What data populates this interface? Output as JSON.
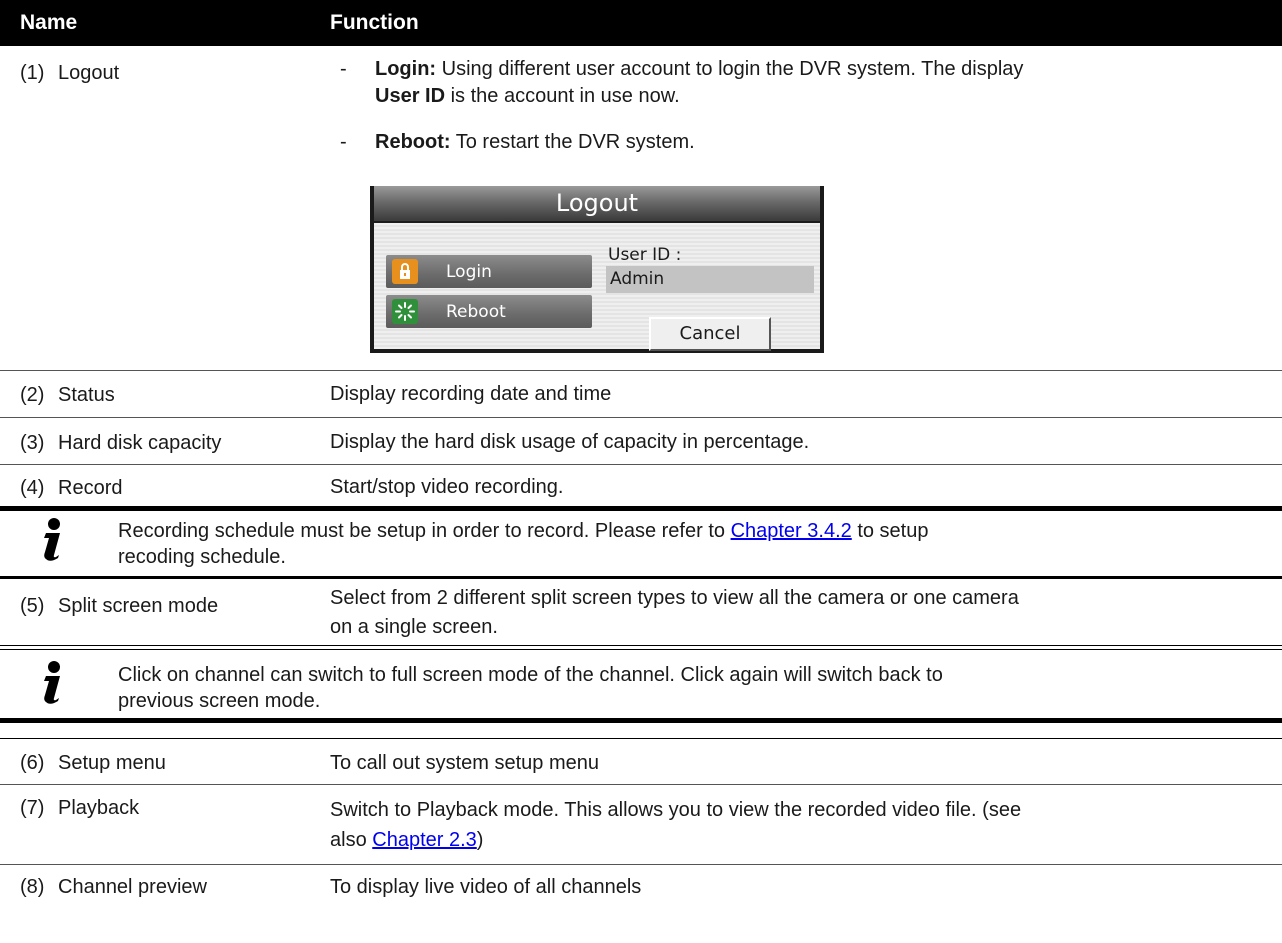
{
  "header": {
    "name": "Name",
    "function": "Function"
  },
  "rows": [
    {
      "num": "(1)",
      "name": "Logout"
    },
    {
      "num": "(2)",
      "name": "Status",
      "function": "Display recording date and time"
    },
    {
      "num": "(3)",
      "name": "Hard disk capacity",
      "function": "Display the hard disk usage of capacity in percentage."
    },
    {
      "num": "(4)",
      "name": "Record",
      "function": "Start/stop video recording."
    },
    {
      "num": "(5)",
      "name": "Split screen mode",
      "function_line1": "Select from 2 different split screen types to view all the camera or one camera",
      "function_line2": "on a single screen."
    },
    {
      "num": "(6)",
      "name": "Setup menu",
      "function": "To call out system setup menu"
    },
    {
      "num": "(7)",
      "name": "Playback",
      "function_line1": "Switch to Playback mode. This allows you to view the recorded video file. (see",
      "function_line2_pre": "also ",
      "function_line2_link": "Chapter 2.3",
      "function_line2_post": ")"
    },
    {
      "num": "(8)",
      "name": "Channel preview",
      "function": "To display live video of all channels"
    }
  ],
  "logout": {
    "dash": "-",
    "login_term": "Login:",
    "login_text1": " Using different user account to login the DVR system. The display",
    "login_term2": "User ID",
    "login_text2": " is the account in use now.",
    "reboot_term": "Reboot:",
    "reboot_text": " To restart the DVR system."
  },
  "dialog": {
    "title": "Logout",
    "login_label": "Login",
    "reboot_label": "Reboot",
    "user_id_label": "User ID :",
    "user_id_value": "Admin",
    "cancel_label": "Cancel"
  },
  "notes": [
    {
      "line1_pre": "Recording schedule must be setup in order to record. Please refer to ",
      "link": "Chapter 3.4.2",
      "line1_post": " to setup",
      "line2": "recoding schedule."
    },
    {
      "line1": "Click on channel can switch to full screen mode of the channel. Click again will switch back to",
      "line2": "previous screen mode."
    }
  ],
  "icons": {
    "note": "info-icon",
    "login": "lock-icon",
    "reboot": "reboot-icon"
  },
  "colors": {
    "link": "#0000ee",
    "header_bg": "#000000",
    "login_icon": "#e8901e",
    "reboot_icon": "#2f8f3a"
  }
}
